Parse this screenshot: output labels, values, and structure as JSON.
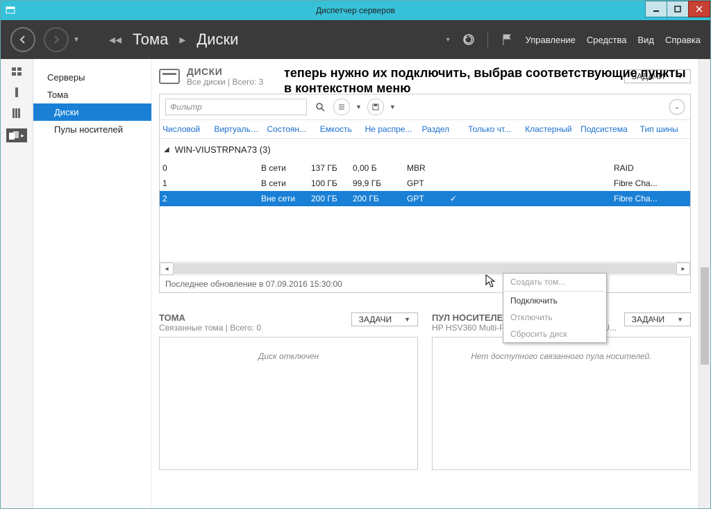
{
  "window": {
    "title": "Диспетчер серверов"
  },
  "header": {
    "breadcrumb": {
      "back_label": "Тома",
      "current": "Диски"
    },
    "menus": {
      "manage": "Управление",
      "tools": "Средства",
      "view": "Вид",
      "help": "Справка"
    }
  },
  "sidebar": {
    "items": [
      {
        "label": "Серверы"
      },
      {
        "label": "Тома"
      },
      {
        "label": "Диски",
        "selected": true
      },
      {
        "label": "Пулы носителей"
      }
    ]
  },
  "annotation": "теперь нужно их подключить, выбрав соответствующие пункты в контекстном меню",
  "disks_panel": {
    "title": "ДИСКИ",
    "subtitle": "Все диски | Всего: 3",
    "tasks_label": "ЗАДАЧИ",
    "filter_placeholder": "Фильтр",
    "columns": {
      "number": "Числовой",
      "virtual": "Виртуальн...",
      "state": "Состоян...",
      "capacity": "Емкость",
      "unalloc": "Не распре...",
      "partition": "Раздел",
      "readonly": "Только чт...",
      "cluster": "Кластерный",
      "subsystem": "Подсистема",
      "bus": "Тип шины"
    },
    "group": "WIN-VIUSTRPNA73 (3)",
    "rows": [
      {
        "num": "0",
        "virtual": "",
        "state": "В сети",
        "cap": "137 ГБ",
        "free": "0,00 Б",
        "part": "MBR",
        "ro": "",
        "bus": "RAID"
      },
      {
        "num": "1",
        "virtual": "",
        "state": "В сети",
        "cap": "100 ГБ",
        "free": "99,9 ГБ",
        "part": "GPT",
        "ro": "",
        "bus": "Fibre Cha..."
      },
      {
        "num": "2",
        "virtual": "",
        "state": "Вне сети",
        "cap": "200 ГБ",
        "free": "200 ГБ",
        "part": "GPT",
        "ro": "✓",
        "bus": "Fibre Cha...",
        "selected": true
      }
    ],
    "status": "Последнее обновление в 07.09.2016 15:30:00"
  },
  "context_menu": {
    "create": "Создать том...",
    "connect": "Подключить",
    "disconnect": "Отключить",
    "reset": "Сбросить диск"
  },
  "volumes_panel": {
    "title": "ТОМА",
    "subtitle": "Связанные тома | Всего: 0",
    "tasks_label": "ЗАДАЧИ",
    "empty": "Диск отключен"
  },
  "pool_panel": {
    "title": "ПУЛ НОСИТЕЛЕЙ",
    "subtitle": "HP HSV360  Multi-Path Disk Device на WIN-VIU...",
    "tasks_label": "ЗАДАЧИ",
    "empty": "Нет доступного связанного пула носителей."
  }
}
